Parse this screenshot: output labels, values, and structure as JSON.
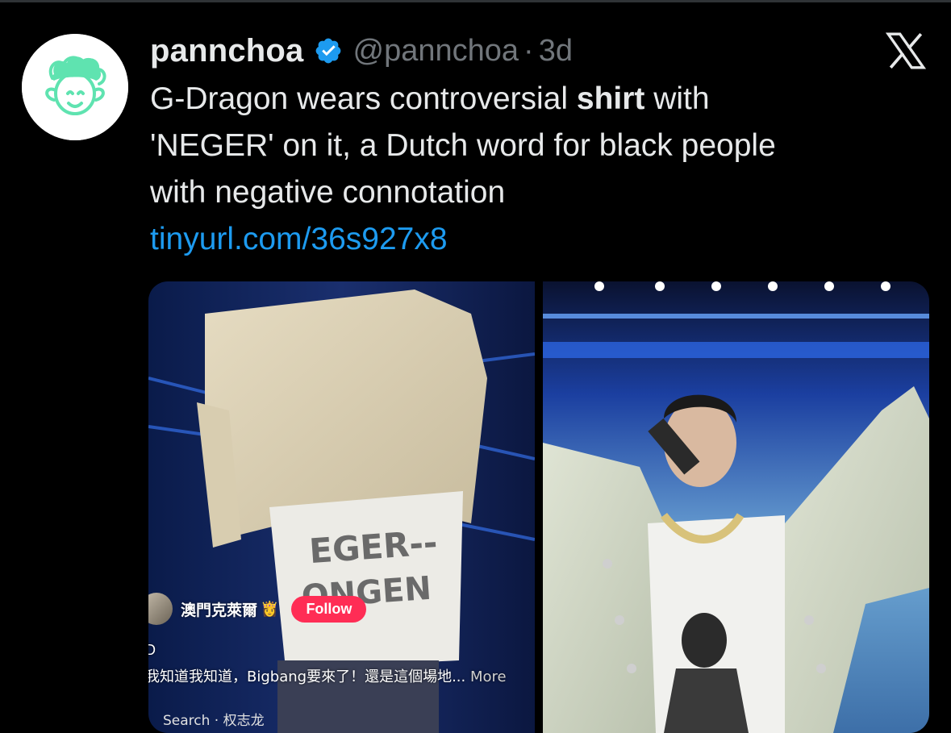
{
  "tweet": {
    "display_name": "pannchoa",
    "verified_icon": "verified-badge-icon",
    "handle": "@pannchoa",
    "separator": "·",
    "age": "3d",
    "text_line1_a": "G-Dragon wears controversial ",
    "text_line1_bold": "shirt",
    "text_line1_b": " with",
    "text_line2": "'NEGER' on it, a Dutch word for black people",
    "text_line3": "with negative connotation",
    "link": "tinyurl.com/36s927x8"
  },
  "brand": {
    "logo_icon": "x-logo-icon",
    "accent": "#1d9bf0",
    "text_primary": "#e7e9ea",
    "text_secondary": "#71767b",
    "avatar_green": "#5fe3b0"
  },
  "media": {
    "left_overlay": {
      "username": "澳門克萊爾",
      "emoji": "👸",
      "follow_label": "Follow",
      "tag": "D",
      "caption": "我知道我知道，Bigbang要來了！還是這個場地...",
      "more_label": "More",
      "search": "Search · 权志龙"
    }
  }
}
